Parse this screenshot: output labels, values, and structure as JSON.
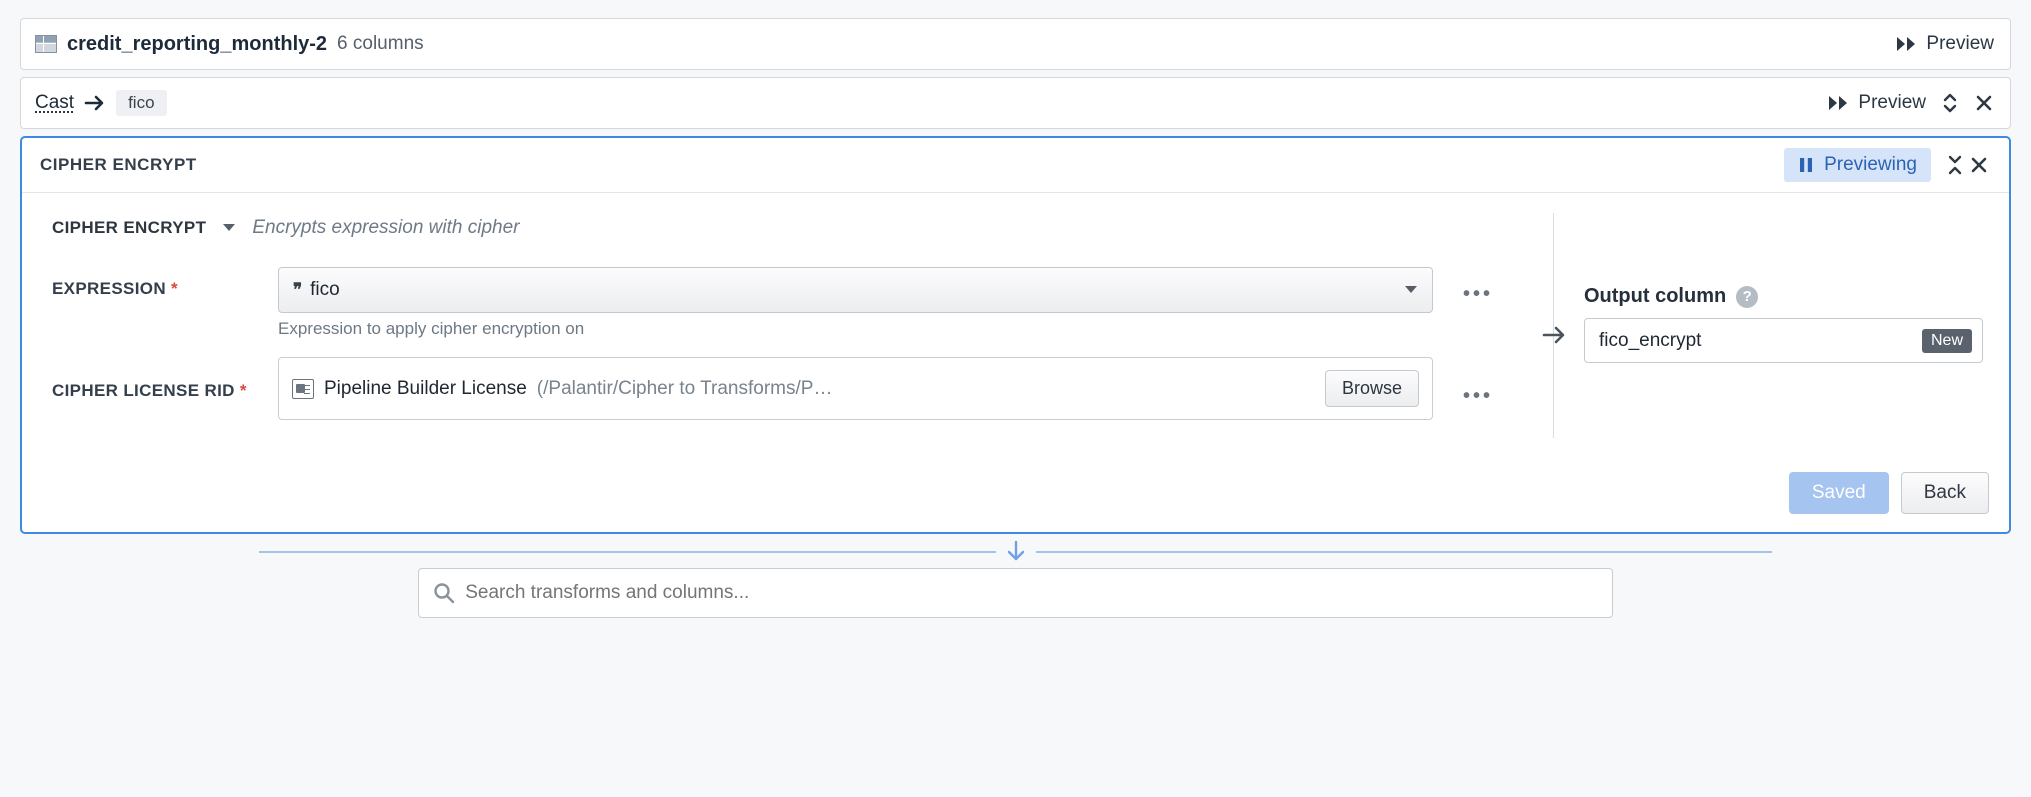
{
  "dataset": {
    "name": "credit_reporting_monthly-2",
    "columns_text": "6 columns",
    "preview_label": "Preview"
  },
  "cast": {
    "label": "Cast",
    "chip": "fico",
    "preview_label": "Preview"
  },
  "panel": {
    "title": "CIPHER ENCRYPT",
    "previewing_label": "Previewing",
    "function_name": "CIPHER ENCRYPT",
    "function_desc": "Encrypts expression with cipher",
    "expression": {
      "label": "EXPRESSION",
      "value": "fico",
      "helper": "Expression to apply cipher encryption on"
    },
    "license": {
      "label": "CIPHER LICENSE RID",
      "name": "Pipeline Builder License",
      "path": "(/Palantir/Cipher to Transforms/P…",
      "browse": "Browse"
    },
    "output": {
      "label": "Output column",
      "value": "fico_encrypt",
      "badge": "New"
    },
    "saved": "Saved",
    "back": "Back"
  },
  "search": {
    "placeholder": "Search transforms and columns..."
  }
}
